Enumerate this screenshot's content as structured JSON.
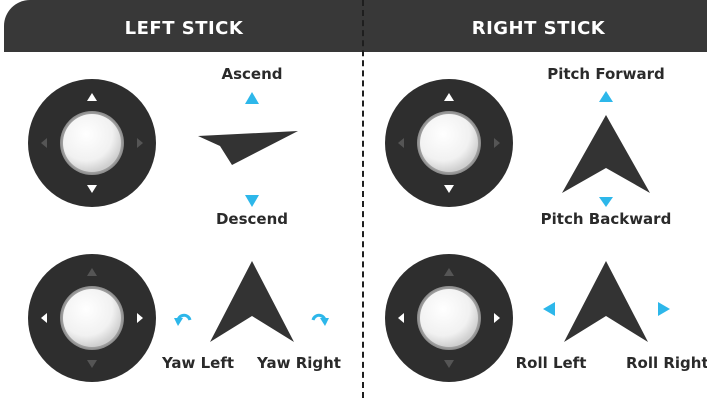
{
  "header": {
    "left_title": "LEFT STICK",
    "right_title": "RIGHT STICK"
  },
  "left_stick": {
    "throttle": {
      "up_label": "Ascend",
      "down_label": "Descend"
    },
    "yaw": {
      "left_label": "Yaw Left",
      "right_label": "Yaw Right"
    }
  },
  "right_stick": {
    "pitch": {
      "up_label": "Pitch Forward",
      "down_label": "Pitch Backward"
    },
    "roll": {
      "left_label": "Roll Left",
      "right_label": "Roll Right"
    }
  },
  "colors": {
    "header_bg": "#383838",
    "pad_dark": "#2e2e2e",
    "indicator_cyan": "#2db7ea",
    "drone_arrow": "#333333"
  },
  "icons": [
    "joystick-pad-icon",
    "triangle-arrow-icon",
    "rotate-ccw-icon",
    "rotate-cw-icon",
    "drone-arrow-icon"
  ]
}
